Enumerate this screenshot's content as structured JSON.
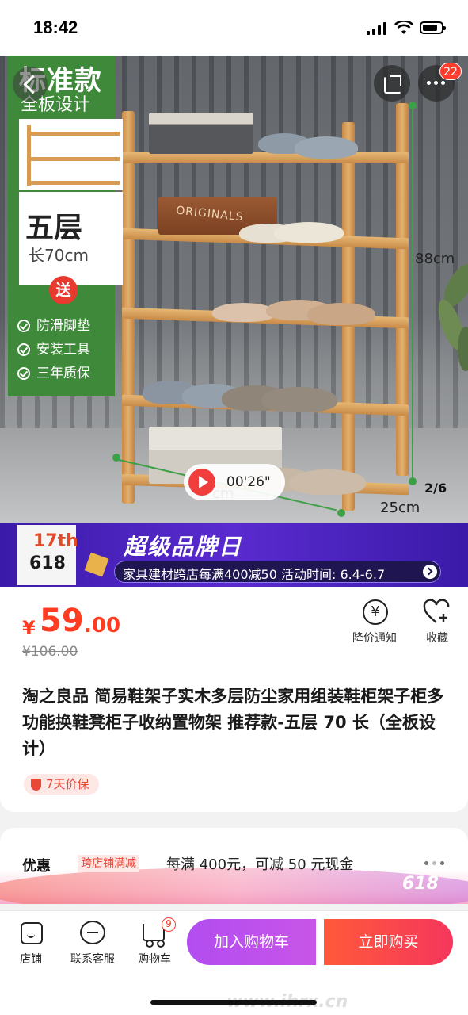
{
  "status_bar": {
    "time": "18:42"
  },
  "hero": {
    "promo_title": "标准款",
    "promo_subtitle": "全板设计",
    "layers": "五层",
    "length": "长70cm",
    "gift_badge": "送",
    "gifts": [
      "防滑脚垫",
      "安装工具",
      "三年质保"
    ],
    "dimension_height": "88cm",
    "dimension_depth": "25cm",
    "dimension_width_partial": "cm",
    "video_time": "00'26\"",
    "page_indicator": "2/6",
    "more_badge": "22",
    "box_text": "ORIGINALS",
    "icons": {
      "back": "back-arrow-icon",
      "share": "share-icon",
      "more": "more-icon"
    }
  },
  "banner": {
    "badge_top": "17th",
    "badge_bottom": "618",
    "title": "超级品牌日",
    "promo_text": "家具建材跨店每满400减50 活动时间: 6.4-6.7"
  },
  "product": {
    "currency": "¥",
    "price_int": "59",
    "price_dec": ".00",
    "original_price": "¥106.00",
    "notify_label": "降价通知",
    "notify_icon_glyph": "¥",
    "fav_label": "收藏",
    "title": "淘之良品 简易鞋架子实木多层防尘家用组装鞋柜架子柜多功能换鞋凳柜子收纳置物架 推荐款-五层 70 长（全板设计）",
    "guarantee": "7天价保"
  },
  "offer": {
    "label": "优惠",
    "tag": "跨店铺满减",
    "text": "每满 400元，可减 50 元现金",
    "badge": "618"
  },
  "bottom_bar": {
    "store_label": "店铺",
    "service_label": "联系客服",
    "cart_label": "购物车",
    "cart_count": "9",
    "add_cart_label": "加入购物车",
    "buy_label": "立即购买",
    "watermark": "www.ihrx.cn"
  },
  "colors": {
    "price_red": "#ff3b20",
    "promo_green": "#3f8a3a",
    "add_cart_purple": "#b24df0",
    "buy_red": "#f5365c",
    "banner_purple": "#3a1aa8"
  }
}
